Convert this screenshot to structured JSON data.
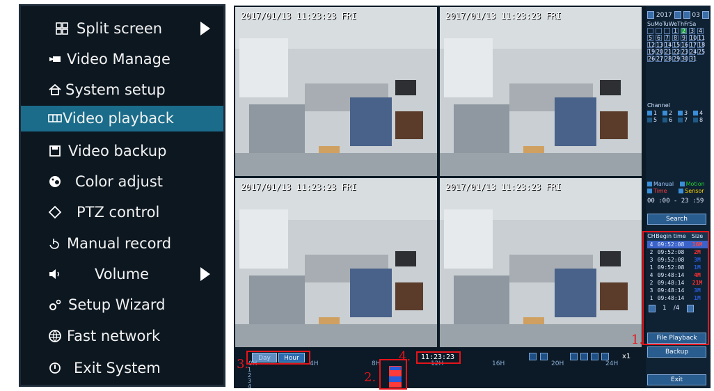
{
  "menu": {
    "items": [
      {
        "label": "Split screen",
        "icon": "split-screen-icon",
        "submenu": true
      },
      {
        "label": "Video Manage",
        "icon": "video-camera-icon"
      },
      {
        "label": "System setup",
        "icon": "home-icon"
      },
      {
        "label": "Video playback",
        "icon": "playback-icon",
        "active": true
      },
      {
        "label": "Video backup",
        "icon": "floppy-icon"
      },
      {
        "label": "Color adjust",
        "icon": "color-palette-icon"
      },
      {
        "label": "PTZ control",
        "icon": "ptz-icon"
      },
      {
        "label": "Manual record",
        "icon": "hand-icon"
      },
      {
        "label": "Volume",
        "icon": "speaker-icon",
        "submenu": true
      },
      {
        "label": "Setup Wizard",
        "icon": "wizard-gears-icon"
      },
      {
        "label": "Fast network",
        "icon": "globe-icon"
      },
      {
        "label": "Exit System",
        "icon": "power-icon"
      }
    ]
  },
  "cameras": [
    {
      "timestamp": "2017/01/13 11:23:23 FRI"
    },
    {
      "timestamp": "2017/01/13 11:23:23 FRI"
    },
    {
      "timestamp": "2017/01/13 11:23:23 FRI"
    },
    {
      "timestamp": "2017/01/13 11:23:23 FRI"
    }
  ],
  "calendar": {
    "year": "2017",
    "month": "03",
    "weekdays": "SuMoTuWeThFrSa",
    "days": [
      "",
      "",
      "",
      "1",
      "2",
      "3",
      "4",
      "5",
      "6",
      "7",
      "8",
      "9",
      "10",
      "11",
      "12",
      "13",
      "14",
      "15",
      "16",
      "17",
      "18",
      "19",
      "20",
      "21",
      "22",
      "23",
      "24",
      "25",
      "26",
      "27",
      "28",
      "29",
      "30",
      "31"
    ],
    "highlight_day": "2"
  },
  "channel": {
    "title": "Channel",
    "items": [
      {
        "num": "1",
        "checked": true
      },
      {
        "num": "2",
        "checked": true
      },
      {
        "num": "3",
        "checked": true
      },
      {
        "num": "4",
        "checked": true
      },
      {
        "num": "5",
        "checked": false
      },
      {
        "num": "6",
        "checked": false
      },
      {
        "num": "7",
        "checked": false
      },
      {
        "num": "8",
        "checked": false
      }
    ]
  },
  "types": {
    "manual": "Manual",
    "motion": "Motion",
    "time": "Time",
    "sensor": "Sensor"
  },
  "time_range": "00 :00  -  23 :59",
  "search_label": "Search",
  "file_table": {
    "headers": [
      "CH",
      "Begin time",
      "Size"
    ],
    "rows": [
      {
        "ch": "4",
        "time": "09:52:08",
        "size": "16M",
        "color": "#ff4444",
        "highlight": true
      },
      {
        "ch": "2",
        "time": "09:52:08",
        "size": "2M",
        "color": "#ff3030"
      },
      {
        "ch": "3",
        "time": "09:52:08",
        "size": "3M",
        "color": "#2a5bd8"
      },
      {
        "ch": "1",
        "time": "09:52:08",
        "size": "1M",
        "color": "#2a5bd8"
      },
      {
        "ch": "4",
        "time": "09:48:14",
        "size": "4M",
        "color": "#ff3030"
      },
      {
        "ch": "2",
        "time": "09:48:14",
        "size": "21M",
        "color": "#ff3030"
      },
      {
        "ch": "3",
        "time": "09:48:14",
        "size": "3M",
        "color": "#2a5bd8"
      },
      {
        "ch": "1",
        "time": "09:48:14",
        "size": "1M",
        "color": "#2a5bd8"
      }
    ],
    "page": "1",
    "total_pages": "/4"
  },
  "buttons": {
    "file_playback": "File Playback",
    "backup": "Backup",
    "exit": "Exit",
    "day": "Day",
    "hour": "Hour"
  },
  "timeline": {
    "current_time": "11:23:23",
    "speed": "x1",
    "ticks": [
      "0H",
      "4H",
      "8H",
      "12H",
      "16H",
      "20H",
      "24H"
    ],
    "channels": [
      "1",
      "2",
      "3",
      "4"
    ]
  },
  "annotations": {
    "a1": "1.",
    "a2": "2.",
    "a3": "3.",
    "a4": "4."
  },
  "colors": {
    "menu_active": "#1a6c8a",
    "annotation_red": "#e5141b",
    "motion_green": "#22cc33",
    "time_red": "#ff3a3a",
    "sensor_yellow": "#ffd400"
  }
}
